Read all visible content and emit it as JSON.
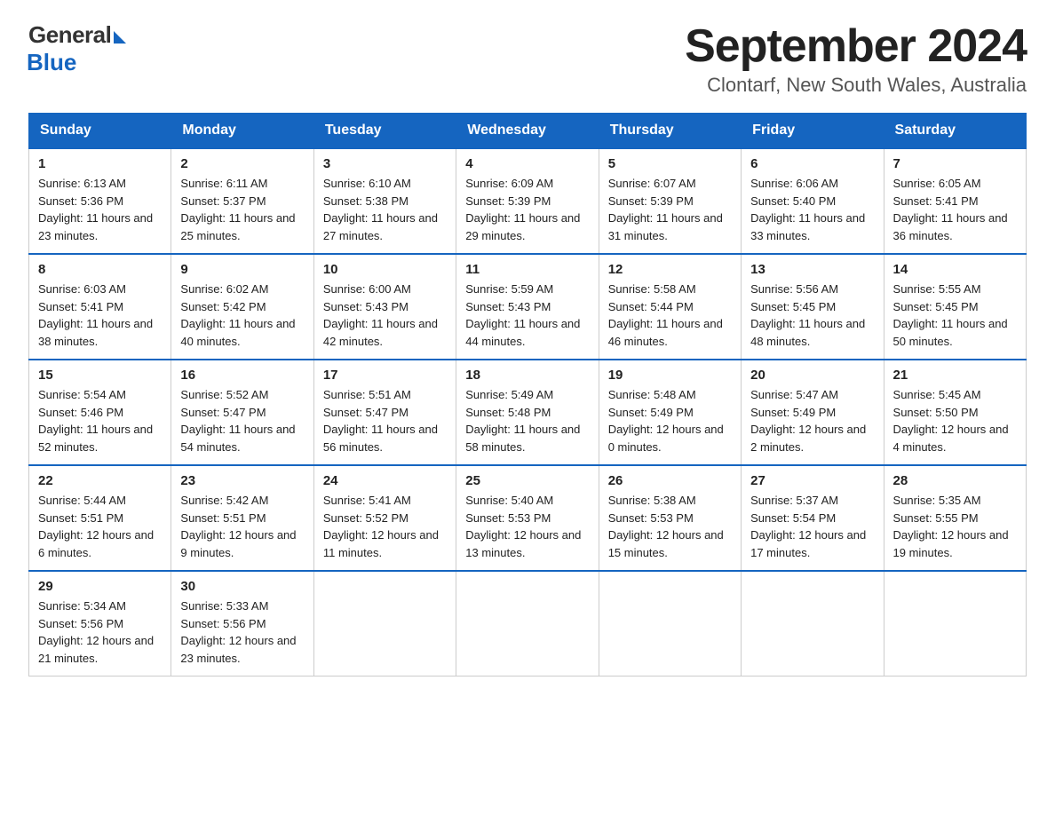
{
  "header": {
    "logo_general": "General",
    "logo_blue": "Blue",
    "month_title": "September 2024",
    "location": "Clontarf, New South Wales, Australia"
  },
  "days_of_week": [
    "Sunday",
    "Monday",
    "Tuesday",
    "Wednesday",
    "Thursday",
    "Friday",
    "Saturday"
  ],
  "weeks": [
    [
      {
        "day": "1",
        "sunrise": "6:13 AM",
        "sunset": "5:36 PM",
        "daylight": "11 hours and 23 minutes."
      },
      {
        "day": "2",
        "sunrise": "6:11 AM",
        "sunset": "5:37 PM",
        "daylight": "11 hours and 25 minutes."
      },
      {
        "day": "3",
        "sunrise": "6:10 AM",
        "sunset": "5:38 PM",
        "daylight": "11 hours and 27 minutes."
      },
      {
        "day": "4",
        "sunrise": "6:09 AM",
        "sunset": "5:39 PM",
        "daylight": "11 hours and 29 minutes."
      },
      {
        "day": "5",
        "sunrise": "6:07 AM",
        "sunset": "5:39 PM",
        "daylight": "11 hours and 31 minutes."
      },
      {
        "day": "6",
        "sunrise": "6:06 AM",
        "sunset": "5:40 PM",
        "daylight": "11 hours and 33 minutes."
      },
      {
        "day": "7",
        "sunrise": "6:05 AM",
        "sunset": "5:41 PM",
        "daylight": "11 hours and 36 minutes."
      }
    ],
    [
      {
        "day": "8",
        "sunrise": "6:03 AM",
        "sunset": "5:41 PM",
        "daylight": "11 hours and 38 minutes."
      },
      {
        "day": "9",
        "sunrise": "6:02 AM",
        "sunset": "5:42 PM",
        "daylight": "11 hours and 40 minutes."
      },
      {
        "day": "10",
        "sunrise": "6:00 AM",
        "sunset": "5:43 PM",
        "daylight": "11 hours and 42 minutes."
      },
      {
        "day": "11",
        "sunrise": "5:59 AM",
        "sunset": "5:43 PM",
        "daylight": "11 hours and 44 minutes."
      },
      {
        "day": "12",
        "sunrise": "5:58 AM",
        "sunset": "5:44 PM",
        "daylight": "11 hours and 46 minutes."
      },
      {
        "day": "13",
        "sunrise": "5:56 AM",
        "sunset": "5:45 PM",
        "daylight": "11 hours and 48 minutes."
      },
      {
        "day": "14",
        "sunrise": "5:55 AM",
        "sunset": "5:45 PM",
        "daylight": "11 hours and 50 minutes."
      }
    ],
    [
      {
        "day": "15",
        "sunrise": "5:54 AM",
        "sunset": "5:46 PM",
        "daylight": "11 hours and 52 minutes."
      },
      {
        "day": "16",
        "sunrise": "5:52 AM",
        "sunset": "5:47 PM",
        "daylight": "11 hours and 54 minutes."
      },
      {
        "day": "17",
        "sunrise": "5:51 AM",
        "sunset": "5:47 PM",
        "daylight": "11 hours and 56 minutes."
      },
      {
        "day": "18",
        "sunrise": "5:49 AM",
        "sunset": "5:48 PM",
        "daylight": "11 hours and 58 minutes."
      },
      {
        "day": "19",
        "sunrise": "5:48 AM",
        "sunset": "5:49 PM",
        "daylight": "12 hours and 0 minutes."
      },
      {
        "day": "20",
        "sunrise": "5:47 AM",
        "sunset": "5:49 PM",
        "daylight": "12 hours and 2 minutes."
      },
      {
        "day": "21",
        "sunrise": "5:45 AM",
        "sunset": "5:50 PM",
        "daylight": "12 hours and 4 minutes."
      }
    ],
    [
      {
        "day": "22",
        "sunrise": "5:44 AM",
        "sunset": "5:51 PM",
        "daylight": "12 hours and 6 minutes."
      },
      {
        "day": "23",
        "sunrise": "5:42 AM",
        "sunset": "5:51 PM",
        "daylight": "12 hours and 9 minutes."
      },
      {
        "day": "24",
        "sunrise": "5:41 AM",
        "sunset": "5:52 PM",
        "daylight": "12 hours and 11 minutes."
      },
      {
        "day": "25",
        "sunrise": "5:40 AM",
        "sunset": "5:53 PM",
        "daylight": "12 hours and 13 minutes."
      },
      {
        "day": "26",
        "sunrise": "5:38 AM",
        "sunset": "5:53 PM",
        "daylight": "12 hours and 15 minutes."
      },
      {
        "day": "27",
        "sunrise": "5:37 AM",
        "sunset": "5:54 PM",
        "daylight": "12 hours and 17 minutes."
      },
      {
        "day": "28",
        "sunrise": "5:35 AM",
        "sunset": "5:55 PM",
        "daylight": "12 hours and 19 minutes."
      }
    ],
    [
      {
        "day": "29",
        "sunrise": "5:34 AM",
        "sunset": "5:56 PM",
        "daylight": "12 hours and 21 minutes."
      },
      {
        "day": "30",
        "sunrise": "5:33 AM",
        "sunset": "5:56 PM",
        "daylight": "12 hours and 23 minutes."
      },
      null,
      null,
      null,
      null,
      null
    ]
  ]
}
